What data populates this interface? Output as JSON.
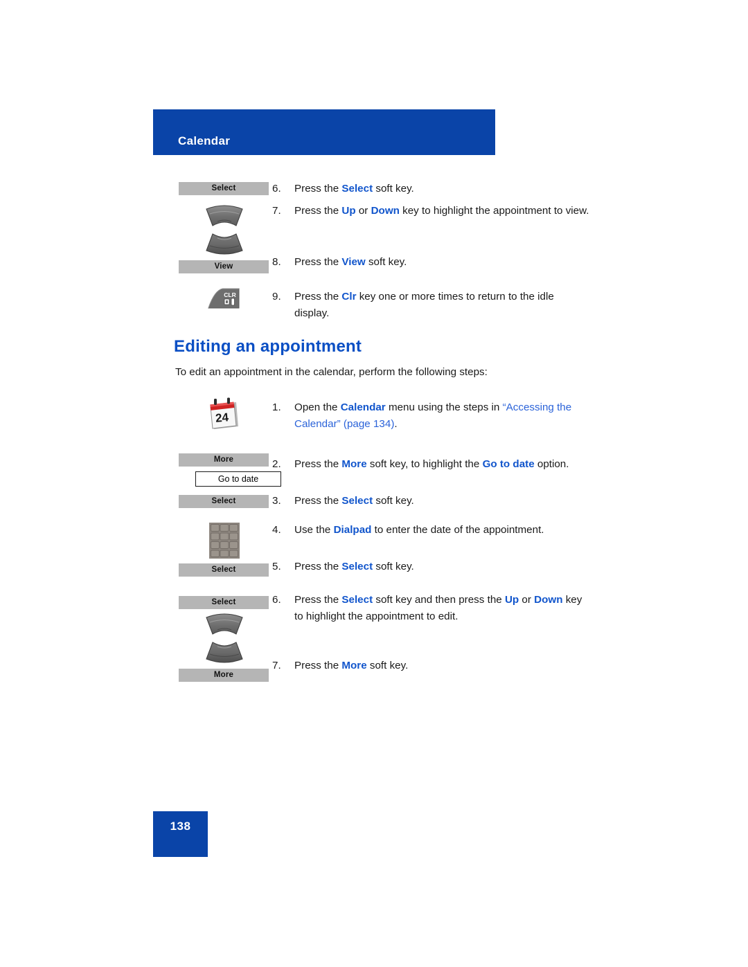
{
  "header": {
    "title": "Calendar",
    "band_color": "#0a44a8"
  },
  "footer": {
    "page_number": "138",
    "block_color": "#0a44a8"
  },
  "section": {
    "heading": "Editing an appointment",
    "intro": "To edit an appointment in the calendar, perform the following steps:",
    "heading_color": "#0b4fc4"
  },
  "top_steps": [
    {
      "num": "6.",
      "icon": "softkey-select",
      "icon_label": "Select",
      "text_parts": [
        {
          "t": "Press the ",
          "style": "plain"
        },
        {
          "t": "Select",
          "style": "keyword"
        },
        {
          "t": " soft key.",
          "style": "plain"
        }
      ]
    },
    {
      "num": "7.",
      "icon": "navigation-keys",
      "icon_label": "",
      "text_parts": [
        {
          "t": "Press the ",
          "style": "plain"
        },
        {
          "t": "Up",
          "style": "keyword"
        },
        {
          "t": " or ",
          "style": "plain"
        },
        {
          "t": "Down",
          "style": "keyword"
        },
        {
          "t": " key to highlight the appointment to view.",
          "style": "plain"
        }
      ]
    },
    {
      "num": "8.",
      "icon": "softkey-view",
      "icon_label": "View",
      "text_parts": [
        {
          "t": "Press the ",
          "style": "plain"
        },
        {
          "t": "View",
          "style": "keyword"
        },
        {
          "t": " soft key.",
          "style": "plain"
        }
      ]
    },
    {
      "num": "9.",
      "icon": "clr-key",
      "icon_label": "CLR",
      "text_parts": [
        {
          "t": "Press the ",
          "style": "plain"
        },
        {
          "t": "Clr",
          "style": "keyword"
        },
        {
          "t": " key one or more times to return to the idle display.",
          "style": "plain"
        }
      ]
    }
  ],
  "edit_steps": [
    {
      "num": "1.",
      "icon": "calendar-icon",
      "icon_label": "24",
      "text_parts": [
        {
          "t": "Open the ",
          "style": "plain"
        },
        {
          "t": "Calendar",
          "style": "keyword"
        },
        {
          "t": " menu using the steps in ",
          "style": "plain"
        },
        {
          "t": "“Accessing the Calendar” (page 134)",
          "style": "xref"
        },
        {
          "t": ".",
          "style": "plain"
        }
      ]
    },
    {
      "num": "2.",
      "icon": "softkey-more-menu",
      "icon_label": "More",
      "menu_label": "Go to date",
      "text_parts": [
        {
          "t": "Press the ",
          "style": "plain"
        },
        {
          "t": "More",
          "style": "keyword"
        },
        {
          "t": " soft key, to highlight the ",
          "style": "plain"
        },
        {
          "t": "Go to date",
          "style": "keyword"
        },
        {
          "t": " option.",
          "style": "plain"
        }
      ]
    },
    {
      "num": "3.",
      "icon": "softkey-select",
      "icon_label": "Select",
      "text_parts": [
        {
          "t": "Press the ",
          "style": "plain"
        },
        {
          "t": "Select",
          "style": "keyword"
        },
        {
          "t": " soft key.",
          "style": "plain"
        }
      ]
    },
    {
      "num": "4.",
      "icon": "dialpad-icon",
      "icon_label": "",
      "text_parts": [
        {
          "t": "Use the ",
          "style": "plain"
        },
        {
          "t": "Dialpad",
          "style": "keyword"
        },
        {
          "t": " to enter the date of the appointment.",
          "style": "plain"
        }
      ]
    },
    {
      "num": "5.",
      "icon": "softkey-select",
      "icon_label": "Select",
      "text_parts": [
        {
          "t": "Press the ",
          "style": "plain"
        },
        {
          "t": "Select",
          "style": "keyword"
        },
        {
          "t": " soft key.",
          "style": "plain"
        }
      ]
    },
    {
      "num": "6.",
      "icon": "softkey-select-nav",
      "icon_label": "Select",
      "text_parts": [
        {
          "t": "Press the ",
          "style": "plain"
        },
        {
          "t": "Select",
          "style": "keyword"
        },
        {
          "t": " soft key and then press the ",
          "style": "plain"
        },
        {
          "t": "Up",
          "style": "keyword"
        },
        {
          "t": " or ",
          "style": "plain"
        },
        {
          "t": "Down",
          "style": "keyword"
        },
        {
          "t": " key to highlight the appointment to edit.",
          "style": "plain"
        }
      ]
    },
    {
      "num": "7.",
      "icon": "softkey-more",
      "icon_label": "More",
      "text_parts": [
        {
          "t": "Press the ",
          "style": "plain"
        },
        {
          "t": "More",
          "style": "keyword"
        },
        {
          "t": " soft key.",
          "style": "plain"
        }
      ]
    }
  ],
  "icon_labels": {
    "select": "Select",
    "view": "View",
    "more": "More",
    "go_to_date": "Go to date",
    "clr": "CLR",
    "calendar_day": "24"
  },
  "colors": {
    "keyword_blue": "#1155cc",
    "xref_blue": "#2b63d9",
    "softkey_gray": "#b5b5b5",
    "brand_blue": "#0a44a8"
  }
}
